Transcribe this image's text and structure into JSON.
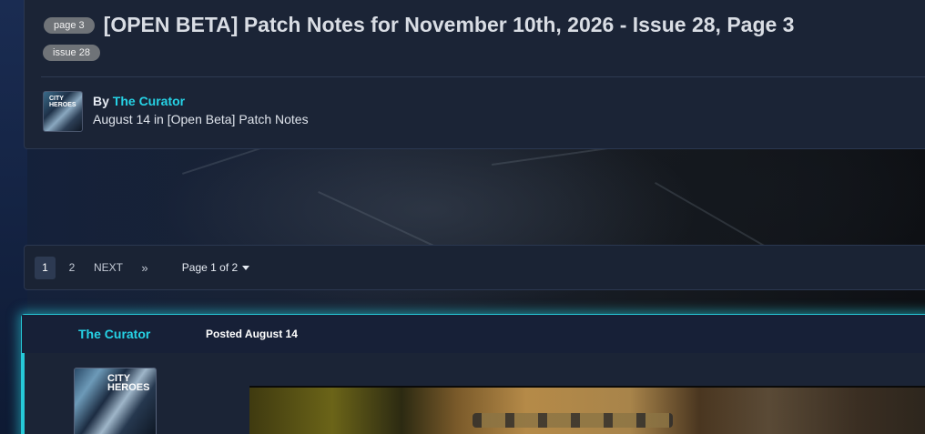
{
  "header": {
    "badge_page": "page 3",
    "title": "[OPEN BETA] Patch Notes for November 10th, 2026 - Issue 28, Page 3",
    "badge_issue": "issue 28",
    "by_prefix": "By",
    "author_name": "The Curator",
    "date_text": "August 14 in [Open Beta] Patch Notes",
    "avatar_text": "CITY HEROES"
  },
  "pagination": {
    "page_1": "1",
    "page_2": "2",
    "next": "NEXT",
    "last": "»",
    "jump": "Page 1 of 2"
  },
  "post": {
    "author_name": "The Curator",
    "posted": "Posted August 14",
    "avatar_text": "CITY HEROES"
  },
  "colors": {
    "accent": "#26d3e6",
    "background": "#1b2436"
  }
}
